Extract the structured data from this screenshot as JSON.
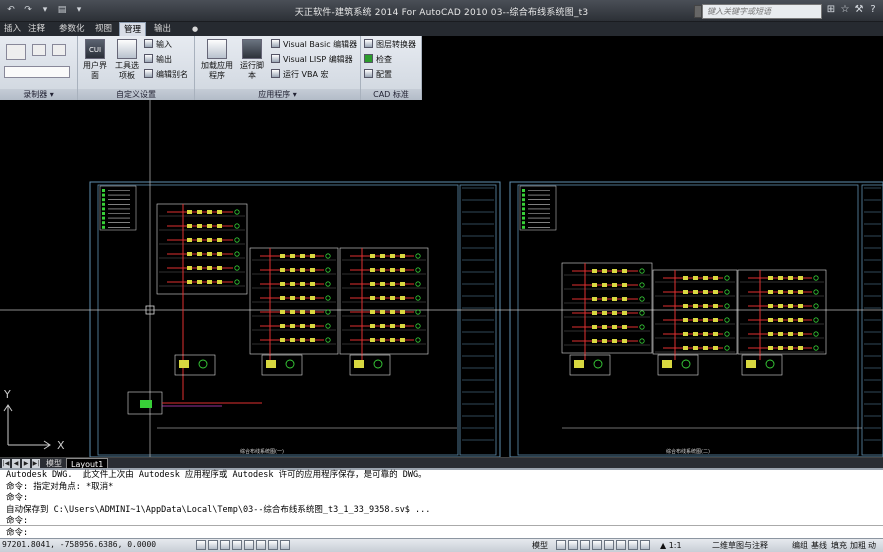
{
  "titlebar": {
    "title": "天正软件-建筑系统 2014  For AutoCAD 2010    03--综合布线系统图_t3",
    "search_placeholder": "键入关键字或短语"
  },
  "ribbon_tabs": [
    "插入",
    "注释",
    "参数化",
    "视图",
    "管理",
    "输出"
  ],
  "active_tab": "管理",
  "ribbon": {
    "panels": [
      {
        "title": "录制器",
        "has_dropdown": true
      },
      {
        "title": "自定义设置",
        "buttons": {
          "cui": "用户界面",
          "tool": "工具选项板",
          "input": "输入",
          "output": "输出",
          "alias": "编辑别名"
        }
      },
      {
        "title": "应用程序",
        "has_dropdown": true,
        "buttons": {
          "load": "加载应用程序",
          "run": "运行脚本",
          "vbe": "Visual Basic 编辑器",
          "lisp": "Visual LISP 编辑器",
          "vba": "运行 VBA 宏"
        }
      },
      {
        "title": "CAD 标准",
        "buttons": {
          "layer": "图层转换器",
          "check": "检查",
          "config": "配置"
        }
      }
    ]
  },
  "drawing": {
    "left_sheet_title": "综合布线系统图(一)",
    "right_sheet_title": "综合布线系统图(二)",
    "ucs_x": "X",
    "ucs_y": "Y"
  },
  "layout_tabs": [
    "模型",
    "Layout1"
  ],
  "active_layout": "模型",
  "command_lines": [
    "Autodesk DWG.  此文件上次由 Autodesk 应用程序或 Autodesk 许可的应用程序保存，是可靠的 DWG。",
    "命令: 指定对角点: *取消*",
    "命令:",
    "自动保存到 C:\\Users\\ADMINI~1\\AppData\\Local\\Temp\\03--综合布线系统图_t3_1_33_9358.sv$ ...",
    "命令:",
    "命令:"
  ],
  "statusbar": {
    "coords": "97201.8041, -758956.6386, 0.0000",
    "model_label": "模型",
    "scale": "1:1",
    "workspace": "二维草图与注释",
    "right_items": [
      "编组",
      "基线",
      "填充",
      "加粗",
      "动态"
    ]
  },
  "colors": {
    "drawing_bg": "#000000",
    "frame": "#5f8fb0",
    "wire_red": "#e03030",
    "device_green": "#38d038",
    "device_yellow": "#d8d840"
  }
}
